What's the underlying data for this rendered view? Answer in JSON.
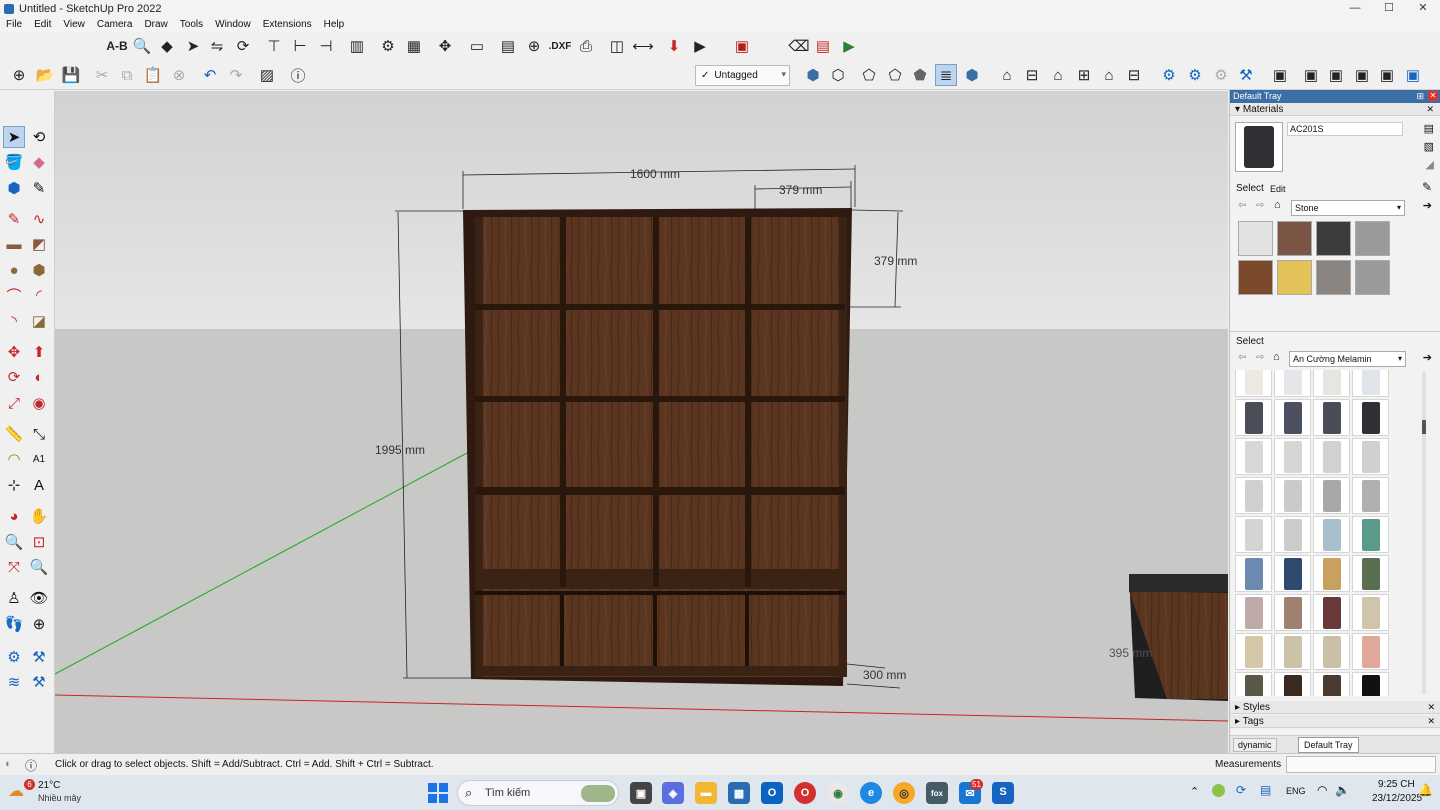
{
  "window": {
    "title": "Untitled - SketchUp Pro 2022",
    "minimize": "—",
    "maximize": "☐",
    "close": "✕"
  },
  "menu": [
    "File",
    "Edit",
    "View",
    "Camera",
    "Draw",
    "Tools",
    "Window",
    "Extensions",
    "Help"
  ],
  "toolbar": {
    "text_tool": "A-B",
    "dxf_label": ".DXF",
    "tag_selected": "Untagged",
    "tag_check": "✓"
  },
  "viewport": {
    "dimensions": {
      "width": "1600 mm",
      "depth_top": "379 mm",
      "shelf_height": "379 mm",
      "height": "1995 mm",
      "base_depth": "300 mm",
      "side_object": "395 mm"
    },
    "colors": {
      "sky": "#dcdcdc",
      "ground": "#c8c8c6",
      "wood_dark": "#3a2418",
      "wood": "#5a3520",
      "axis_red": "#cc2222",
      "axis_green": "#22aa22"
    }
  },
  "tray": {
    "title": "Default Tray",
    "pin": "⊞",
    "materials_label": "Materials",
    "material_name": "AC201S",
    "tab_select": "Select",
    "tab_edit": "Edit",
    "collection1": "Stone",
    "collection2": "An Cường Melamin",
    "select2": "Select",
    "styles_label": "Styles",
    "tags_label": "Tags",
    "tabs": [
      "dynamic",
      "Default Tray"
    ],
    "stone_colors": [
      "#e2e2e2",
      "#7a5546",
      "#3a3c3e",
      "#9a9a98",
      "#7a4a2a",
      "#e3c25a",
      "#8a8580",
      "#9a9a9a"
    ],
    "melamine_colors": [
      "#ece8e2",
      "#e4e6ea",
      "#e6e6e0",
      "#e2e4ec",
      "#4a4e58",
      "#4c5060",
      "#4a4c58",
      "#2e3034",
      "#d8d8d8",
      "#d6d6d6",
      "#d2d2d2",
      "#d0d0d0",
      "#cfcfcf",
      "#cacaca",
      "#a8a8a8",
      "#b0b0b0",
      "#d4d4d4",
      "#cccccc",
      "#a8c0cc",
      "#5a9a8a",
      "#6a8ab0",
      "#2e4a6e",
      "#c8a060",
      "#5a6e50",
      "#c0aaa8",
      "#a08070",
      "#6a3a3a",
      "#d0c4aa",
      "#d4c8a8",
      "#ccc2aa",
      "#cac0a8",
      "#e0a898",
      "#5a5848",
      "#3a2a20",
      "#4a3a30",
      "#111111"
    ]
  },
  "status": {
    "info_icon": "ⓘ",
    "hint": "Click or drag to select objects. Shift = Add/Subtract. Ctrl = Add. Shift + Ctrl = Subtract.",
    "measurements_label": "Measurements"
  },
  "taskbar": {
    "weather_temp": "21°C",
    "weather_desc": "Nhiều mây",
    "weather_badge": "6",
    "search_placeholder": "Tìm kiếm",
    "lang": "ENG",
    "time": "9:25 CH",
    "date": "23/12/2025",
    "mail_badge": "51"
  }
}
